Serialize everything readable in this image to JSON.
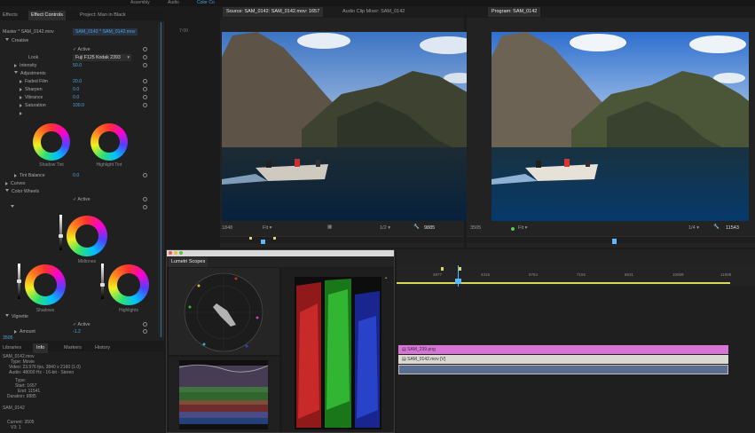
{
  "top_workspaces": [
    {
      "label": "Assembly"
    },
    {
      "label": "Audio"
    },
    {
      "label": "Color Co"
    }
  ],
  "effect_panel": {
    "tabs": [
      "Effects",
      "Effect Controls",
      "Project: Man in Black"
    ],
    "master_label": "Master * SAM_0142.mov",
    "clip_label": "SAM_0142 * SAM_0142.mov",
    "timecode_start": "7:00",
    "creative": "Creative",
    "active_label": "Active",
    "look_label": "Look",
    "look_value": "Fuji F125 Kodak 2393",
    "intensity_label": "Intensity",
    "intensity_value": "50.0",
    "adjustments_label": "Adjustments",
    "faded_film_label": "Faded Film",
    "faded_film_value": "20.0",
    "sharpen_label": "Sharpen",
    "sharpen_value": "0.0",
    "vibrance_label": "Vibrance",
    "vibrance_value": "0.0",
    "saturation_label": "Saturation",
    "saturation_value": "100.0",
    "shadow_tint": "Shadow Tint",
    "highlight_tint": "Highlight Tint",
    "tint_balance_label": "Tint Balance",
    "tint_balance_value": "0.0",
    "curves_label": "Curves",
    "color_wheels_label": "Color Wheels",
    "active2_label": "Active",
    "midtones": "Midtones",
    "shadows": "Shadows",
    "highlights": "Highlights",
    "vignette_label": "Vignette",
    "active3_label": "Active",
    "amount_label": "Amount",
    "amount_value": "-1.2",
    "footer_timecode": "3505"
  },
  "info_panel": {
    "tabs": [
      "Libraries",
      "Info",
      "Markers",
      "History"
    ],
    "lines": [
      "SAM_0142.mov",
      "Type: Movie",
      "Video: 23.976 fps, 3840 x 2160 (1.0)",
      "Audio: 48000 Hz - 16-bit - Stereo",
      "Type:",
      "Start: 1657",
      "End: 11541",
      "Duration: 9885",
      "",
      "SAM_0142",
      "",
      "Current: 3505",
      "V3: 1"
    ]
  },
  "source_monitor": {
    "tabs": [
      "Source: SAM_0142: SAM_0142.mov: 1657",
      "Audio Clip Mixer: SAM_0142"
    ],
    "timecode": "1848",
    "fit": "Fit",
    "resolution": "1/2",
    "duration": "9885"
  },
  "program_monitor": {
    "tab": "Program: SAM_0142",
    "timecode": "3505",
    "fit": "Fit",
    "resolution": "1/4",
    "duration": "11543"
  },
  "lumetri_scopes": {
    "title": "Lumetri Scopes"
  },
  "timeline": {
    "ruler": [
      "2877",
      "4315",
      "5754",
      "7192",
      "8631",
      "10069",
      "11508"
    ],
    "clips": [
      {
        "label": "SAM_239.png",
        "color": "#d874d8"
      },
      {
        "label": "SAM_0142.mov [V]",
        "color": "#d9d9d2"
      },
      {
        "label": "",
        "color": "#5a6f8f"
      }
    ]
  },
  "colors": {
    "accent": "#4aa3df",
    "playhead": "#5fb8ff",
    "timeline_marker": "#d8d85a"
  }
}
